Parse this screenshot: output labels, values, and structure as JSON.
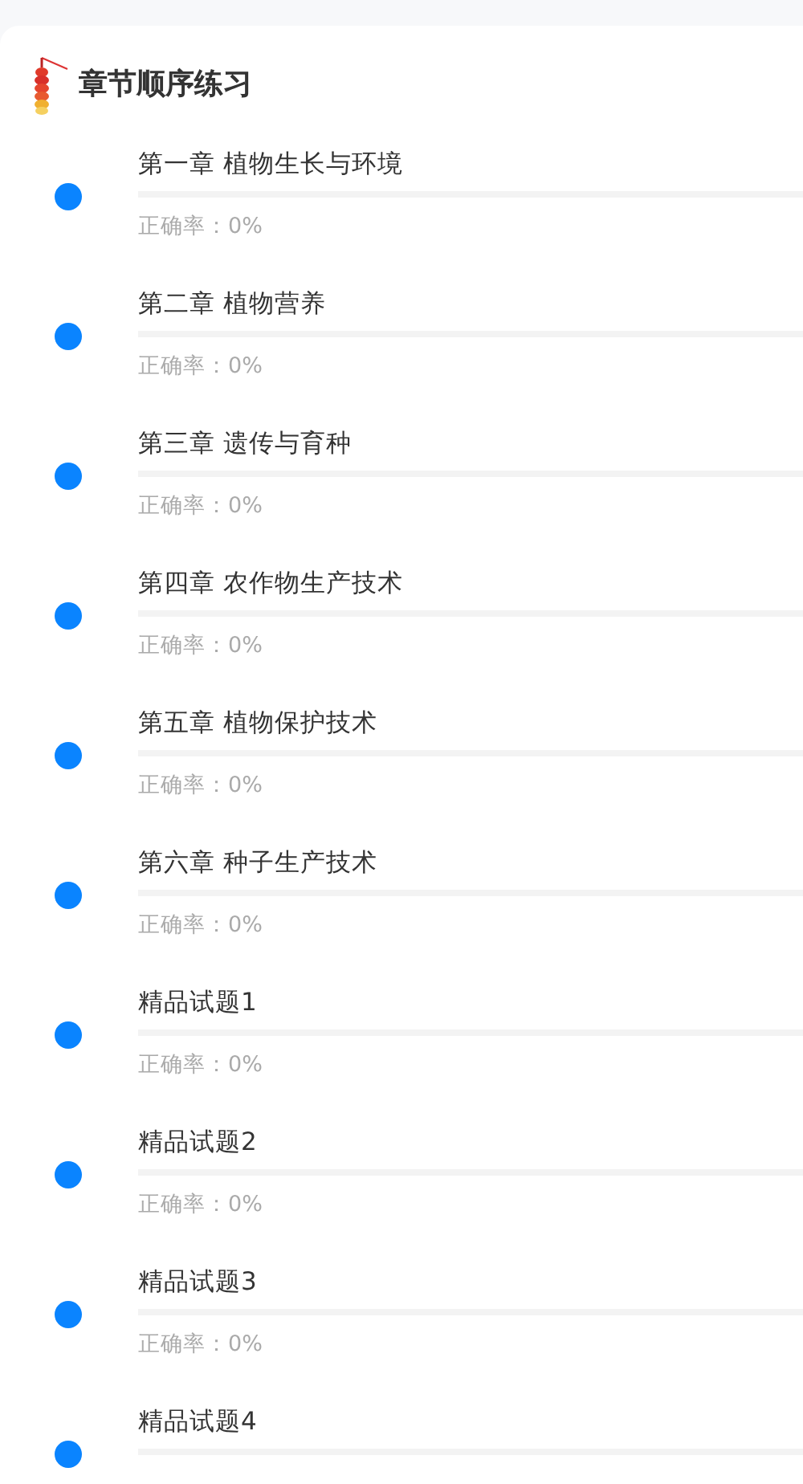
{
  "section": {
    "title": "章节顺序练习"
  },
  "chapters": [
    {
      "title": "第一章 植物生长与环境",
      "level": 0,
      "accuracy": "正确率：0%"
    },
    {
      "title": "第二章 植物营养",
      "level": 0,
      "accuracy": "正确率：0%"
    },
    {
      "title": "第三章 遗传与育种",
      "level": 0,
      "accuracy": "正确率：0%"
    },
    {
      "title": "第四章 农作物生产技术",
      "level": 0,
      "accuracy": "正确率：0%"
    },
    {
      "title": "第五章 植物保护技术",
      "level": 0,
      "accuracy": "正确率：0%"
    },
    {
      "title": "第六章 种子生产技术",
      "level": 0,
      "accuracy": "正确率：0%"
    },
    {
      "title": "精品试题1",
      "level": 0,
      "accuracy": "正确率：0%"
    },
    {
      "title": "精品试题2",
      "level": 0,
      "accuracy": "正确率：0%"
    },
    {
      "title": "精品试题3",
      "level": 0,
      "accuracy": "正确率：0%"
    },
    {
      "title": "精品试题4",
      "level": 0
    }
  ]
}
